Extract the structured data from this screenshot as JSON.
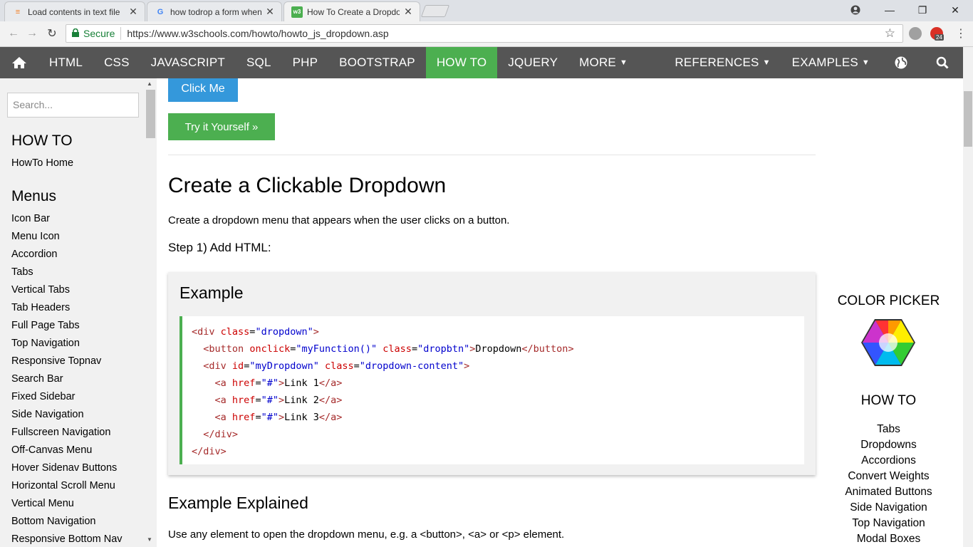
{
  "browser": {
    "tabs": [
      {
        "title": "Load contents in text file",
        "close": "✕"
      },
      {
        "title": "how todrop a form when",
        "close": "✕"
      },
      {
        "title": "How To Create a Dropdown",
        "close": "✕"
      }
    ],
    "window_controls": {
      "minimize": "—",
      "restore": "❐",
      "close": "✕"
    },
    "secure_label": "Secure",
    "url": "https://www.w3schools.com/howto/howto_js_dropdown.asp",
    "extension_badge": "24",
    "colors": {
      "tabstrip": "#dee1e6",
      "secure": "#188038"
    }
  },
  "topnav": {
    "items": [
      "HTML",
      "CSS",
      "JAVASCRIPT",
      "SQL",
      "PHP",
      "BOOTSTRAP",
      "HOW TO",
      "JQUERY",
      "MORE"
    ],
    "active": "HOW TO",
    "right_items": [
      "REFERENCES",
      "EXAMPLES"
    ],
    "icons": [
      "home-icon",
      "globe-icon",
      "search-icon"
    ],
    "colors": {
      "bar": "#555555",
      "active": "#4caf50"
    }
  },
  "sidebar": {
    "search_placeholder": "Search...",
    "section1_title": "HOW TO",
    "section1_links": [
      "HowTo Home"
    ],
    "section2_title": "Menus",
    "links": [
      "Icon Bar",
      "Menu Icon",
      "Accordion",
      "Tabs",
      "Vertical Tabs",
      "Tab Headers",
      "Full Page Tabs",
      "Top Navigation",
      "Responsive Topnav",
      "Search Bar",
      "Fixed Sidebar",
      "Side Navigation",
      "Fullscreen Navigation",
      "Off-Canvas Menu",
      "Hover Sidenav Buttons",
      "Horizontal Scroll Menu",
      "Vertical Menu",
      "Bottom Navigation",
      "Responsive Bottom Nav"
    ]
  },
  "main": {
    "click_button": "Click Me",
    "try_button": "Try it Yourself »",
    "heading": "Create a Clickable Dropdown",
    "intro": "Create a dropdown menu that appears when the user clicks on a button.",
    "step": "Step 1) Add HTML:",
    "example_title": "Example",
    "code_lines": [
      "<div class=\"dropdown\">",
      "  <button onclick=\"myFunction()\" class=\"dropbtn\">Dropdown</button>",
      "  <div id=\"myDropdown\" class=\"dropdown-content\">",
      "    <a href=\"#\">Link 1</a>",
      "    <a href=\"#\">Link 2</a>",
      "    <a href=\"#\">Link 3</a>",
      "  </div>",
      "</div>"
    ],
    "explained_title": "Example Explained",
    "explained_text": "Use any element to open the dropdown menu, e.g. a <button>, <a> or <p> element.",
    "colors": {
      "click_button": "#3498db",
      "try_button": "#4caf50",
      "code_border": "#4caf50"
    }
  },
  "right": {
    "color_picker_title": "COLOR PICKER",
    "howto_title": "HOW TO",
    "links": [
      "Tabs",
      "Dropdowns",
      "Accordions",
      "Convert Weights",
      "Animated Buttons",
      "Side Navigation",
      "Top Navigation",
      "Modal Boxes"
    ]
  }
}
